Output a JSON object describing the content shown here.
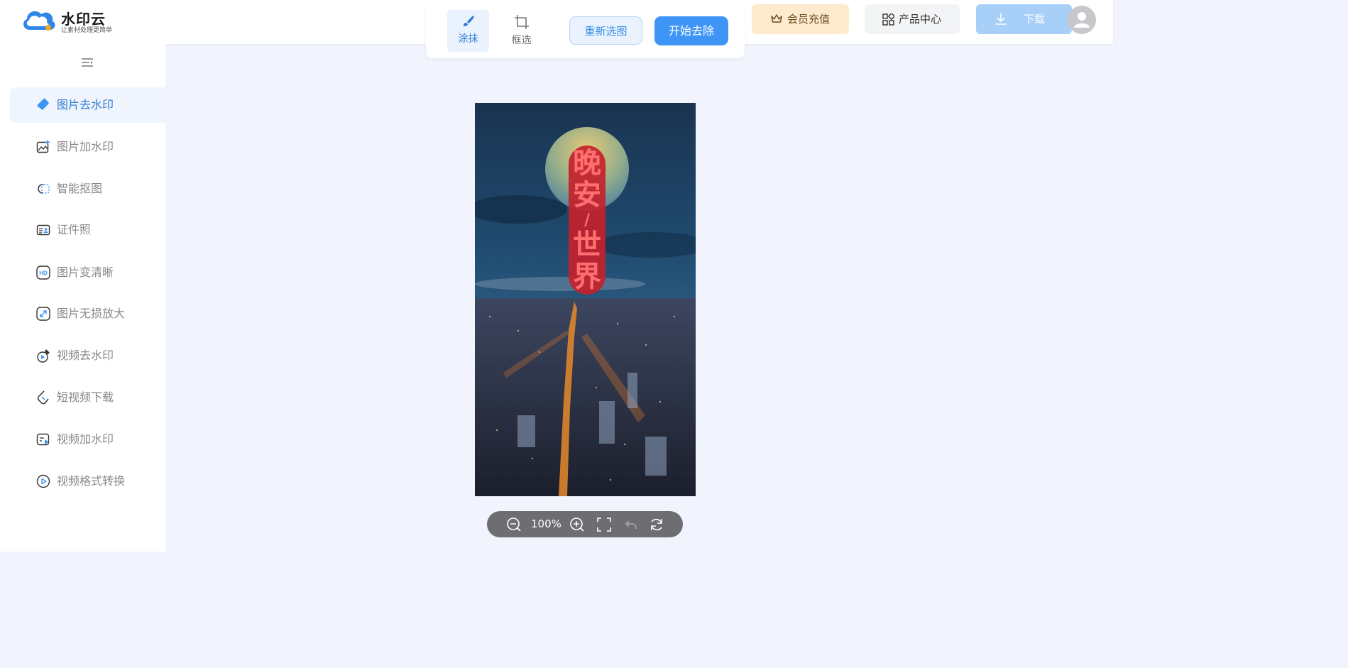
{
  "brand": {
    "name": "水印云",
    "slogan": "让素材处理更简单"
  },
  "toolbar": {
    "tool_brush": "涂抹",
    "tool_box": "框选",
    "reselect_label": "重新选图",
    "start_label": "开始去除"
  },
  "header": {
    "vip_label": "会员充值",
    "products_label": "产品中心",
    "download_label": "下载"
  },
  "sidebar": {
    "items": [
      {
        "label": "图片去水印",
        "icon": "eraser-icon",
        "active": true
      },
      {
        "label": "图片加水印",
        "icon": "image-add-icon"
      },
      {
        "label": "智能抠图",
        "icon": "cutout-icon"
      },
      {
        "label": "证件照",
        "icon": "id-card-icon"
      },
      {
        "label": "图片变清晰",
        "icon": "hd-icon"
      },
      {
        "label": "图片无损放大",
        "icon": "enlarge-icon"
      },
      {
        "label": "视频去水印",
        "icon": "video-eraser-icon"
      },
      {
        "label": "短视频下载",
        "icon": "short-video-download-icon"
      },
      {
        "label": "视频加水印",
        "icon": "video-add-icon"
      },
      {
        "label": "视频格式转换",
        "icon": "video-convert-icon"
      }
    ]
  },
  "canvas": {
    "poster_text": [
      "晚",
      "安",
      "/",
      "世",
      "界"
    ],
    "zoom": "100%"
  },
  "colors": {
    "accent": "#3e95f6",
    "active_text": "#2f7ed8",
    "vip_bg": "#feeacd"
  }
}
